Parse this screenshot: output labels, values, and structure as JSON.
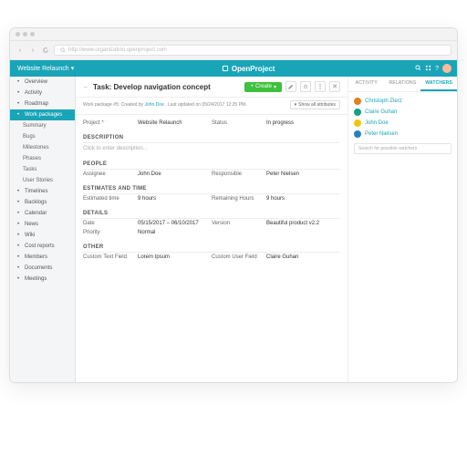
{
  "url": "http://www.organization.openproject.com",
  "brand": "OpenProject",
  "project_selector": "Website Relaunch",
  "sidebar": {
    "items": [
      {
        "label": "Overview"
      },
      {
        "label": "Activity"
      },
      {
        "label": "Roadmap"
      },
      {
        "label": "Work packages",
        "active": true
      },
      {
        "label": "Summary",
        "sub": true
      },
      {
        "label": "Bugs",
        "sub": true
      },
      {
        "label": "Milestones",
        "sub": true
      },
      {
        "label": "Phases",
        "sub": true
      },
      {
        "label": "Tasks",
        "sub": true
      },
      {
        "label": "User Stories",
        "sub": true
      },
      {
        "label": "Timelines"
      },
      {
        "label": "Backlogs"
      },
      {
        "label": "Calendar"
      },
      {
        "label": "News"
      },
      {
        "label": "Wiki"
      },
      {
        "label": "Cost reports"
      },
      {
        "label": "Members"
      },
      {
        "label": "Documents"
      },
      {
        "label": "Meetings"
      }
    ]
  },
  "header": {
    "title": "Task: Develop navigation concept",
    "meta_prefix": "Work package #5: Created by ",
    "author": "John Doe",
    "meta_suffix": ". Last updated on 05/24/2017 12:25 PM.",
    "show_all": "Show all attributes",
    "create": "Create"
  },
  "fields": {
    "project": {
      "label": "Project",
      "value": "Website Relaunch"
    },
    "status": {
      "label": "Status",
      "value": "In progress"
    },
    "description": {
      "heading": "DESCRIPTION",
      "placeholder": "Click to enter description..."
    },
    "people": {
      "heading": "PEOPLE",
      "assignee_l": "Assignee",
      "assignee_v": "John Doe",
      "resp_l": "Responsible",
      "resp_v": "Peter Nielsen"
    },
    "est": {
      "heading": "ESTIMATES AND TIME",
      "est_l": "Estimated time",
      "est_v": "9 hours",
      "rem_l": "Remaining Hours",
      "rem_v": "9 hours"
    },
    "details": {
      "heading": "DETAILS",
      "date_l": "Date",
      "date_v": "05/15/2017 – 06/10/2017",
      "ver_l": "Version",
      "ver_v": "Beautiful product v2.2",
      "prio_l": "Priority",
      "prio_v": "Normal"
    },
    "other": {
      "heading": "OTHER",
      "ctf_l": "Custom Text Field",
      "ctf_v": "Lorem Ipsum",
      "cuf_l": "Custom User Field",
      "cuf_v": "Claire Guhan"
    }
  },
  "panel": {
    "tabs": [
      "ACTIVITY",
      "RELATIONS",
      "WATCHERS"
    ],
    "active": 2,
    "watchers": [
      {
        "name": "Christoph Zierz",
        "color": "#e67e22"
      },
      {
        "name": "Claire Guhan",
        "color": "#16a085"
      },
      {
        "name": "John Doe",
        "color": "#f1c40f"
      },
      {
        "name": "Peter Nielsen",
        "color": "#2980b9"
      }
    ],
    "search_ph": "Search for possible watchers"
  }
}
